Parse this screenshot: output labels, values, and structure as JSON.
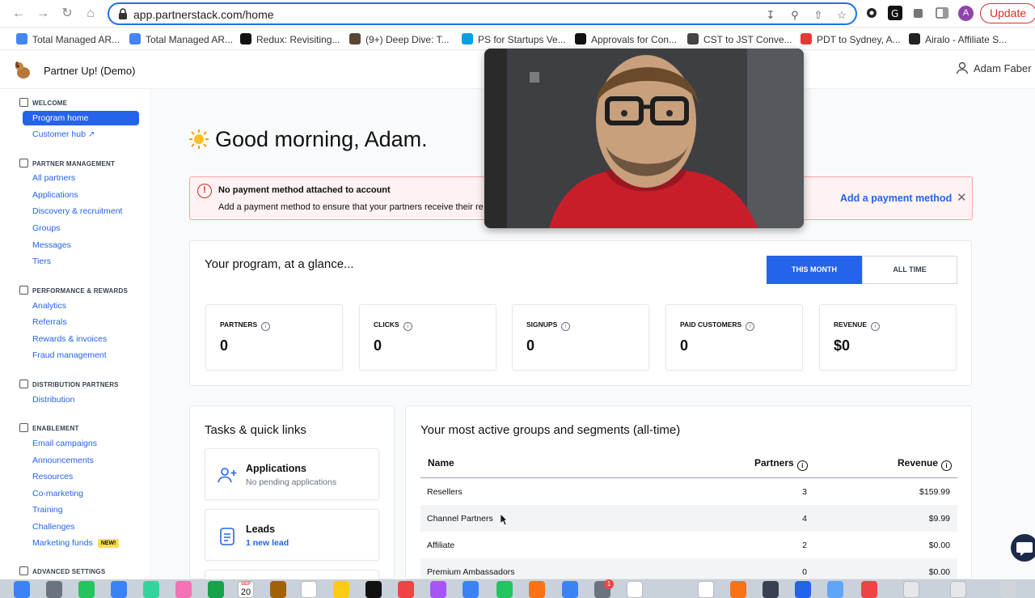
{
  "browser": {
    "url": "app.partnerstack.com/home",
    "update_label": "Update",
    "profile_initial": "A",
    "bookmarks": [
      {
        "label": "Total Managed AR...",
        "color": "#4285f4"
      },
      {
        "label": "Total Managed AR...",
        "color": "#4285f4"
      },
      {
        "label": "Redux: Revisiting...",
        "color": "#111111"
      },
      {
        "label": "(9+) Deep Dive: T...",
        "color": "#5b4636"
      },
      {
        "label": "PS for Startups Ve...",
        "color": "#00a1e0"
      },
      {
        "label": "Approvals for Con...",
        "color": "#111111"
      },
      {
        "label": "CST to JST Conve...",
        "color": "#444444"
      },
      {
        "label": "PDT to Sydney, A...",
        "color": "#e53935"
      },
      {
        "label": "Airalo - Affiliate S...",
        "color": "#222222"
      }
    ]
  },
  "app": {
    "program_name": "Partner Up! (Demo)",
    "user_name": "Adam Faber"
  },
  "sidebar": {
    "sections": [
      {
        "title": "WELCOME",
        "items": [
          {
            "label": "Program home",
            "active": true
          },
          {
            "label": "Customer hub",
            "external": true
          }
        ]
      },
      {
        "title": "PARTNER MANAGEMENT",
        "items": [
          {
            "label": "All partners"
          },
          {
            "label": "Applications"
          },
          {
            "label": "Discovery & recruitment"
          },
          {
            "label": "Groups"
          },
          {
            "label": "Messages"
          },
          {
            "label": "Tiers"
          }
        ]
      },
      {
        "title": "PERFORMANCE & REWARDS",
        "items": [
          {
            "label": "Analytics"
          },
          {
            "label": "Referrals"
          },
          {
            "label": "Rewards & invoices"
          },
          {
            "label": "Fraud management"
          }
        ]
      },
      {
        "title": "DISTRIBUTION PARTNERS",
        "items": [
          {
            "label": "Distribution"
          }
        ]
      },
      {
        "title": "ENABLEMENT",
        "items": [
          {
            "label": "Email campaigns"
          },
          {
            "label": "Announcements"
          },
          {
            "label": "Resources"
          },
          {
            "label": "Co-marketing"
          },
          {
            "label": "Training"
          },
          {
            "label": "Challenges"
          },
          {
            "label": "Marketing funds",
            "badge": "NEW!"
          }
        ]
      },
      {
        "title": "ADVANCED SETTINGS",
        "items": []
      }
    ]
  },
  "main": {
    "greeting": "Good morning, Adam.",
    "alert": {
      "title": "No payment method attached to account",
      "body": "Add a payment method to ensure that your partners receive their re",
      "link": "Add a payment method"
    },
    "glance": {
      "title": "Your program, at a glance...",
      "toggle_active": "THIS MONTH",
      "toggle_inactive": "ALL TIME",
      "stats": [
        {
          "label": "PARTNERS",
          "value": "0"
        },
        {
          "label": "CLICKS",
          "value": "0"
        },
        {
          "label": "SIGNUPS",
          "value": "0"
        },
        {
          "label": "PAID CUSTOMERS",
          "value": "0"
        },
        {
          "label": "REVENUE",
          "value": "$0"
        }
      ]
    },
    "tasks": {
      "title": "Tasks & quick links",
      "items": [
        {
          "title": "Applications",
          "subtitle": "No pending applications",
          "icon": "add-user-icon"
        },
        {
          "title": "Leads",
          "subtitle": "1 new lead",
          "icon": "document-icon"
        }
      ]
    },
    "groups": {
      "title": "Your most active groups and segments (all-time)",
      "columns": [
        "Name",
        "Partners",
        "Revenue"
      ],
      "rows": [
        {
          "name": "Resellers",
          "partners": "3",
          "revenue": "$159.99"
        },
        {
          "name": "Channel Partners",
          "partners": "4",
          "revenue": "$9.99"
        },
        {
          "name": "Affiliate",
          "partners": "2",
          "revenue": "$0.00"
        },
        {
          "name": "Premium Ambassadors",
          "partners": "0",
          "revenue": "$0.00"
        }
      ]
    }
  },
  "dock": {
    "calendar_month": "SEP",
    "calendar_day": "20",
    "notification_badge": "1"
  }
}
